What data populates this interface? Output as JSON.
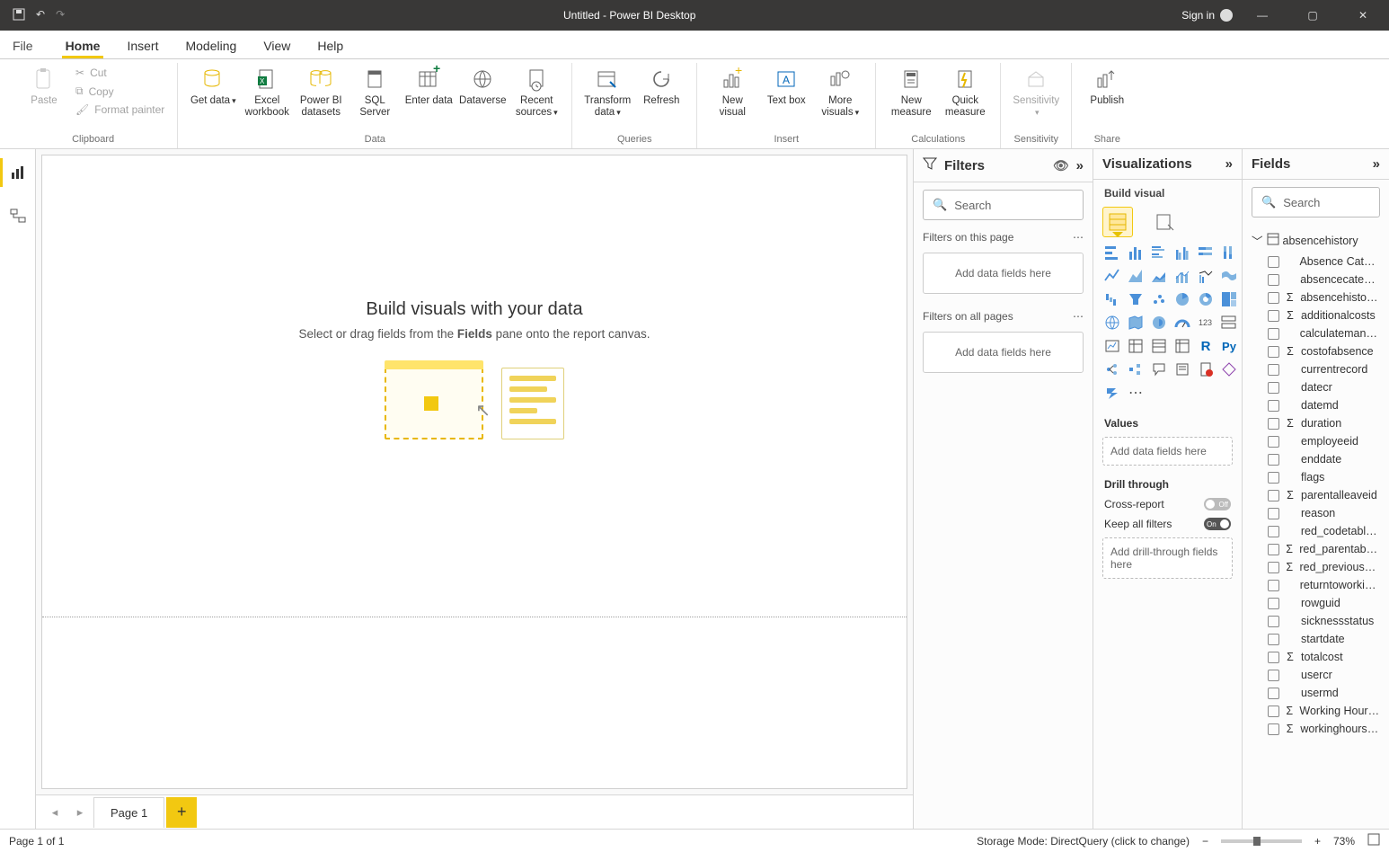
{
  "titlebar": {
    "title": "Untitled - Power BI Desktop",
    "signin": "Sign in"
  },
  "tabs": {
    "file": "File",
    "home": "Home",
    "insert": "Insert",
    "modeling": "Modeling",
    "view": "View",
    "help": "Help"
  },
  "clipboard": {
    "paste": "Paste",
    "cut": "Cut",
    "copy": "Copy",
    "format_painter": "Format painter",
    "group": "Clipboard"
  },
  "data_group": {
    "getdata": "Get data",
    "excel": "Excel workbook",
    "pbids": "Power BI datasets",
    "sql": "SQL Server",
    "enter": "Enter data",
    "dataverse": "Dataverse",
    "recent": "Recent sources",
    "group": "Data"
  },
  "queries": {
    "transform": "Transform data",
    "refresh": "Refresh",
    "group": "Queries"
  },
  "insert_group": {
    "newvisual": "New visual",
    "textbox": "Text box",
    "more": "More visuals",
    "group": "Insert"
  },
  "calc": {
    "newmeasure": "New measure",
    "quick": "Quick measure",
    "group": "Calculations"
  },
  "sens": {
    "sensitivity": "Sensitivity",
    "group": "Sensitivity"
  },
  "share": {
    "publish": "Publish",
    "group": "Share"
  },
  "canvas": {
    "heading": "Build visuals with your data",
    "sub_pre": "Select or drag fields from the ",
    "sub_bold": "Fields",
    "sub_post": " pane onto the report canvas."
  },
  "pagetabs": {
    "page1": "Page 1"
  },
  "filters": {
    "title": "Filters",
    "search": "Search",
    "on_page": "Filters on this page",
    "on_all": "Filters on all pages",
    "add": "Add data fields here"
  },
  "viz": {
    "title": "Visualizations",
    "build": "Build visual",
    "values": "Values",
    "values_drop": "Add data fields here",
    "drill": "Drill through",
    "cross": "Cross-report",
    "keep": "Keep all filters",
    "drill_drop": "Add drill-through fields here",
    "off": "Off",
    "on": "On"
  },
  "fields_pane": {
    "title": "Fields",
    "search": "Search",
    "table": "absencehistory",
    "fields": [
      {
        "name": "Absence Category",
        "sigma": false
      },
      {
        "name": "absencecategory",
        "sigma": false
      },
      {
        "name": "absencehistoryid",
        "sigma": true
      },
      {
        "name": "additionalcosts",
        "sigma": true
      },
      {
        "name": "calculatemanually",
        "sigma": false
      },
      {
        "name": "costofabsence",
        "sigma": true
      },
      {
        "name": "currentrecord",
        "sigma": false
      },
      {
        "name": "datecr",
        "sigma": false
      },
      {
        "name": "datemd",
        "sigma": false
      },
      {
        "name": "duration",
        "sigma": true
      },
      {
        "name": "employeeid",
        "sigma": false
      },
      {
        "name": "enddate",
        "sigma": false
      },
      {
        "name": "flags",
        "sigma": false
      },
      {
        "name": "parentalleaveid",
        "sigma": true
      },
      {
        "name": "reason",
        "sigma": false
      },
      {
        "name": "red_codetableid",
        "sigma": false
      },
      {
        "name": "red_parentabsen...",
        "sigma": true
      },
      {
        "name": "red_previousabs...",
        "sigma": true
      },
      {
        "name": "returntoworkinte...",
        "sigma": false
      },
      {
        "name": "rowguid",
        "sigma": false
      },
      {
        "name": "sicknessstatus",
        "sigma": false
      },
      {
        "name": "startdate",
        "sigma": false
      },
      {
        "name": "totalcost",
        "sigma": true
      },
      {
        "name": "usercr",
        "sigma": false
      },
      {
        "name": "usermd",
        "sigma": false
      },
      {
        "name": "Working Hours L...",
        "sigma": true
      },
      {
        "name": "workinghourslost",
        "sigma": true
      }
    ]
  },
  "status": {
    "left": "Page 1 of 1",
    "mode": "Storage Mode: DirectQuery (click to change)",
    "zoom": "73%"
  }
}
